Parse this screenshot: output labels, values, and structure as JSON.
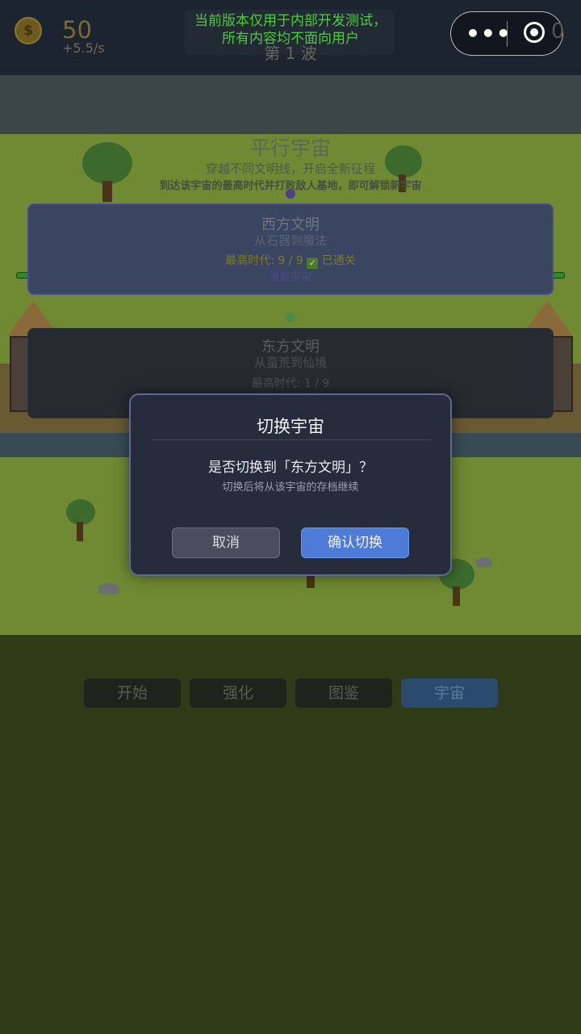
{
  "hud": {
    "gold_value": "50",
    "gold_rate": "+5.5/s",
    "coin_symbol": "$",
    "wave_label": "第 1 波",
    "dev_notice_line1": "当前版本仅用于内部开发测试，",
    "dev_notice_line2": "所有内容均不面向用户"
  },
  "capsule": {
    "more_glyph": "•••",
    "hidden_counter": "0"
  },
  "universe": {
    "title": "平行宇宙",
    "subtitle": "穿越不同文明线，开启全新征程",
    "hint": "到达该宇宙的最高时代并打败敌人基地，即可解锁新宇宙",
    "cards": [
      {
        "name": "西方文明",
        "desc": "从石器到魔法",
        "era": "最高时代: 9 / 9",
        "cleared": "已通关",
        "current": "当前宇宙"
      },
      {
        "name": "东方文明",
        "desc": "从蛮荒到仙境",
        "era": "最高时代: 1 / 9"
      }
    ]
  },
  "tabs": [
    "开始",
    "强化",
    "图鉴",
    "宇宙"
  ],
  "active_tab": "宇宙",
  "dialog": {
    "title": "切换宇宙",
    "question": "是否切换到「东方文明」？",
    "note": "切换后将从该宇宙的存档继续",
    "cancel_label": "取消",
    "confirm_label": "确认切换"
  },
  "colors": {
    "confirm_button": "#4f7bd8",
    "dev_notice": "#4ecb3e",
    "dialog_bg": "#262c3c"
  }
}
